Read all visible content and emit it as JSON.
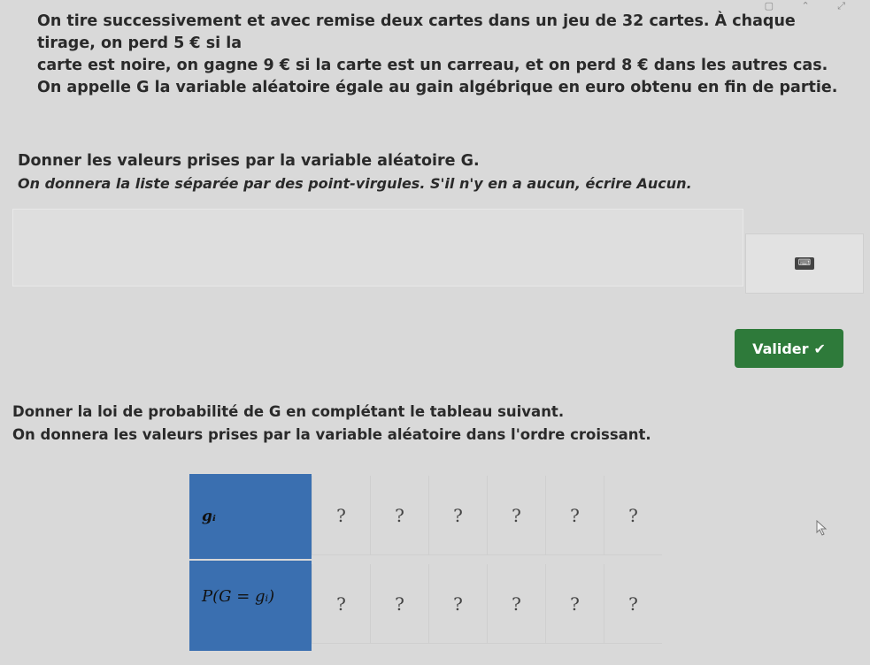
{
  "problem": {
    "lines": [
      "On tire successivement et avec remise deux cartes dans un jeu de 32 cartes. À chaque tirage, on perd 5 € si la",
      "carte est noire, on gagne 9 € si la carte est un carreau, et on perd 8 € dans les autres cas.",
      "On appelle G la variable aléatoire égale au gain algébrique en euro obtenu en fin de partie."
    ]
  },
  "question1": {
    "title": "Donner les valeurs prises par la variable aléatoire G.",
    "hint": "On donnera la liste séparée par des point-virgules. S'il n'y en a aucun, écrire Aucun.",
    "answer_value": "",
    "keyboard_label": "⌨",
    "validate_label": "Valider",
    "validate_icon": "✔"
  },
  "question2": {
    "title": "Donner la loi de probabilité de G en complétant le tableau suivant.",
    "hint": "On donnera les valeurs prises par la variable aléatoire dans l'ordre croissant.",
    "table": {
      "row_g_label": "gᵢ",
      "row_p_label": "P(G = gᵢ)",
      "row_g_values": [
        "?",
        "?",
        "?",
        "?",
        "?",
        "?"
      ],
      "row_p_values": [
        "?",
        "?",
        "?",
        "?",
        "?",
        "?"
      ]
    }
  },
  "colors": {
    "header_blue": "#3a6fb0",
    "validate_green": "#2e7a3a"
  }
}
